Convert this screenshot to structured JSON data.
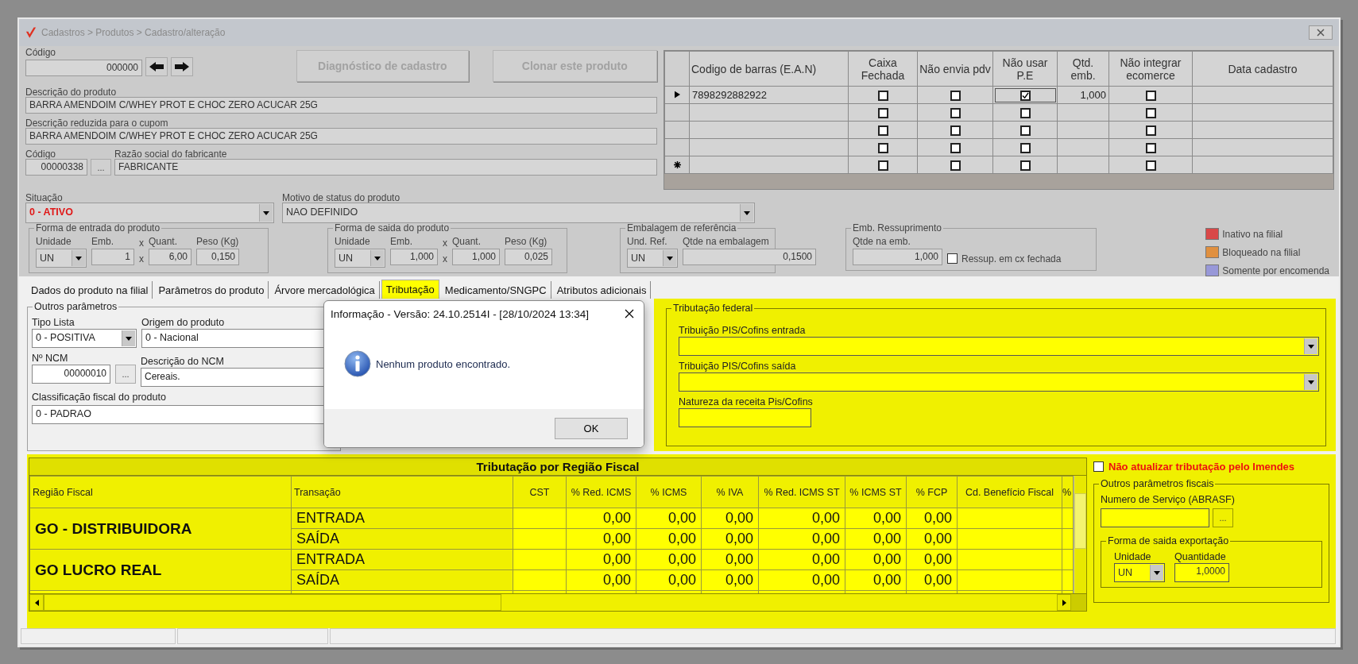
{
  "window": {
    "title": "Cadastros > Produtos > Cadastro/alteração"
  },
  "product": {
    "code": {
      "label": "Código",
      "value": "000000"
    },
    "actions": [
      {
        "label": "Diagnóstico de cadastro",
        "disabled": true
      },
      {
        "label": "Clonar este produto",
        "disabled": true
      }
    ],
    "description": {
      "label": "Descrição  do produto",
      "value": "BARRA AMENDOIM C/WHEY PROT E CHOC ZERO ACUCAR 25G"
    },
    "short_description": {
      "label": "Descrição reduzida para o cupom",
      "value": "BARRA AMENDOIM C/WHEY PROT E CHOC ZERO ACUCAR 25G"
    },
    "manufacturer": {
      "code_label": "Código",
      "code": "00000338",
      "browse": "...",
      "name_label": "Razão social do fabricante",
      "name": "FABRICANTE"
    },
    "status": {
      "label": "Situação",
      "value": "0 - ATIVO"
    },
    "status_reason": {
      "label": "Motivo de status do produto",
      "value": "NAO DEFINIDO"
    }
  },
  "barcodes": {
    "columns": [
      "Codigo de barras (E.A.N)",
      "Caixa Fechada",
      "Não envia pdv",
      "Não usar P.E",
      "Qtd. emb.",
      "Não integrar ecomerce",
      "Data cadastro"
    ],
    "rows": [
      {
        "current": true,
        "new_row": false,
        "ean": "7898292882922",
        "caixa_fechada": false,
        "nao_envia_pdv": false,
        "nao_usar_pe": true,
        "qtd_emb": "1,000",
        "nao_integrar_ecomerce": false
      },
      {
        "current": false,
        "new_row": false,
        "caixa_fechada": false,
        "nao_envia_pdv": false,
        "nao_usar_pe": false,
        "nao_integrar_ecomerce": false
      },
      {
        "current": false,
        "new_row": false,
        "caixa_fechada": false,
        "nao_envia_pdv": false,
        "nao_usar_pe": false,
        "nao_integrar_ecomerce": false
      },
      {
        "current": false,
        "new_row": false,
        "caixa_fechada": false,
        "nao_envia_pdv": false,
        "nao_usar_pe": false,
        "nao_integrar_ecomerce": false
      },
      {
        "current": false,
        "new_row": true,
        "caixa_fechada": false,
        "nao_envia_pdv": false,
        "nao_usar_pe": false,
        "nao_integrar_ecomerce": false
      }
    ]
  },
  "groups": [
    {
      "title": "Forma de entrada do produto",
      "fields": [
        {
          "kind": "select",
          "label": "Unidade",
          "value": "UN"
        },
        {
          "kind": "text",
          "label": "Emb.",
          "value": "1"
        },
        {
          "kind": "times",
          "top_sign": "x",
          "bottom_sign": "x"
        },
        {
          "kind": "text",
          "label": "Quant.",
          "value": "6,00"
        },
        {
          "kind": "text",
          "label": "Peso (Kg)",
          "value": "0,150"
        }
      ]
    },
    {
      "title": "Forma de saida do produto",
      "fields": [
        {
          "kind": "select",
          "label": "Unidade",
          "value": "UN"
        },
        {
          "kind": "text",
          "label": "Emb.",
          "value": "1,000"
        },
        {
          "kind": "times",
          "top_sign": "x",
          "bottom_sign": "x"
        },
        {
          "kind": "text",
          "label": "Quant.",
          "value": "1,000"
        },
        {
          "kind": "text",
          "label": "Peso (Kg)",
          "value": "0,025"
        }
      ]
    },
    {
      "title": "Embalagem de referência",
      "fields": [
        {
          "kind": "select",
          "label": "Und. Ref.",
          "value": "UN"
        },
        {
          "kind": "wide",
          "label": "Qtde na embalagem",
          "value": "0,1500"
        }
      ]
    },
    {
      "title": "Emb. Ressuprimento",
      "fields": [
        {
          "kind": "wide",
          "label": "Qtde na emb.",
          "value": "1,000"
        },
        {
          "kind": "checkbox",
          "label": "Ressup. em cx fechada",
          "checked": false
        }
      ]
    }
  ],
  "legend": [
    {
      "label": "Inativo na filial",
      "color": "#d94848"
    },
    {
      "label": "Bloqueado na filial",
      "color": "#e09040"
    },
    {
      "label": "Somente por encomenda",
      "color": "#9898d8"
    }
  ],
  "tabs": [
    {
      "label": "Dados do produto na filial",
      "selected": false
    },
    {
      "label": "Parâmetros do produto",
      "selected": false
    },
    {
      "label": "Árvore mercadológica",
      "selected": false
    },
    {
      "label": "Tributação",
      "selected": true
    },
    {
      "label": "Medicamento/SNGPC",
      "selected": false
    },
    {
      "label": "Atributos adicionais",
      "selected": false
    }
  ],
  "other_params": {
    "title": "Outros parâmetros",
    "list_type": {
      "label": "Tipo Lista",
      "value": "0 - POSITIVA"
    },
    "origin": {
      "label": "Origem do produto",
      "value": "0 - Nacional"
    },
    "ncm": {
      "label": "Nº NCM",
      "value": "00000010",
      "browse": "..."
    },
    "ncm_description": {
      "label": "Descrição do NCM",
      "value": "Cereais."
    },
    "fiscal_class": {
      "label": "Classificação fiscal do produto",
      "value": "0 - PADRAO"
    }
  },
  "federal_tax": {
    "title": "Tributação federal",
    "pis_in": {
      "label": "Tribuição PIS/Cofins entrada"
    },
    "pis_out": {
      "label": "Tribuição PIS/Cofins saída"
    },
    "nature": {
      "label": "Natureza da receita Pis/Cofins"
    }
  },
  "regional_tax": {
    "title": "Tributação por Região Fiscal",
    "columns": [
      "Região Fiscal",
      "Transação",
      "CST",
      "% Red. ICMS",
      "% ICMS",
      "% IVA",
      "% Red. ICMS ST",
      "% ICMS ST",
      "% FCP",
      "Cd. Benefício Fiscal",
      "%"
    ],
    "regions": [
      {
        "name": "GO - DISTRIBUIDORA",
        "transactions": [
          {
            "name": "ENTRADA",
            "values": [
              "0,00",
              "0,00",
              "0,00",
              "0,00",
              "0,00",
              "0,00"
            ]
          },
          {
            "name": "SAÍDA",
            "values": [
              "0,00",
              "0,00",
              "0,00",
              "0,00",
              "0,00",
              "0,00"
            ]
          }
        ]
      },
      {
        "name": "GO LUCRO REAL",
        "transactions": [
          {
            "name": "ENTRADA",
            "values": [
              "0,00",
              "0,00",
              "0,00",
              "0,00",
              "0,00",
              "0,00"
            ]
          },
          {
            "name": "SAÍDA",
            "values": [
              "0,00",
              "0,00",
              "0,00",
              "0,00",
              "0,00",
              "0,00"
            ]
          }
        ]
      }
    ]
  },
  "imendes": {
    "label": "Não atualizar tributação pelo Imendes",
    "checked": false
  },
  "fiscal_params": {
    "title": "Outros parâmetros fiscais",
    "service": {
      "label": "Numero de Serviço (ABRASF)",
      "browse": "..."
    },
    "export": {
      "title": "Forma de saida exportação",
      "unit": {
        "label": "Unidade",
        "value": "UN"
      },
      "quantity": {
        "label": "Quantidade",
        "value": "1,0000"
      }
    }
  },
  "dialog": {
    "title": "Informação - Versão: 24.10.2514I - [28/10/2024 13:34]",
    "message": "Nenhum produto encontrado.",
    "button": "OK"
  }
}
